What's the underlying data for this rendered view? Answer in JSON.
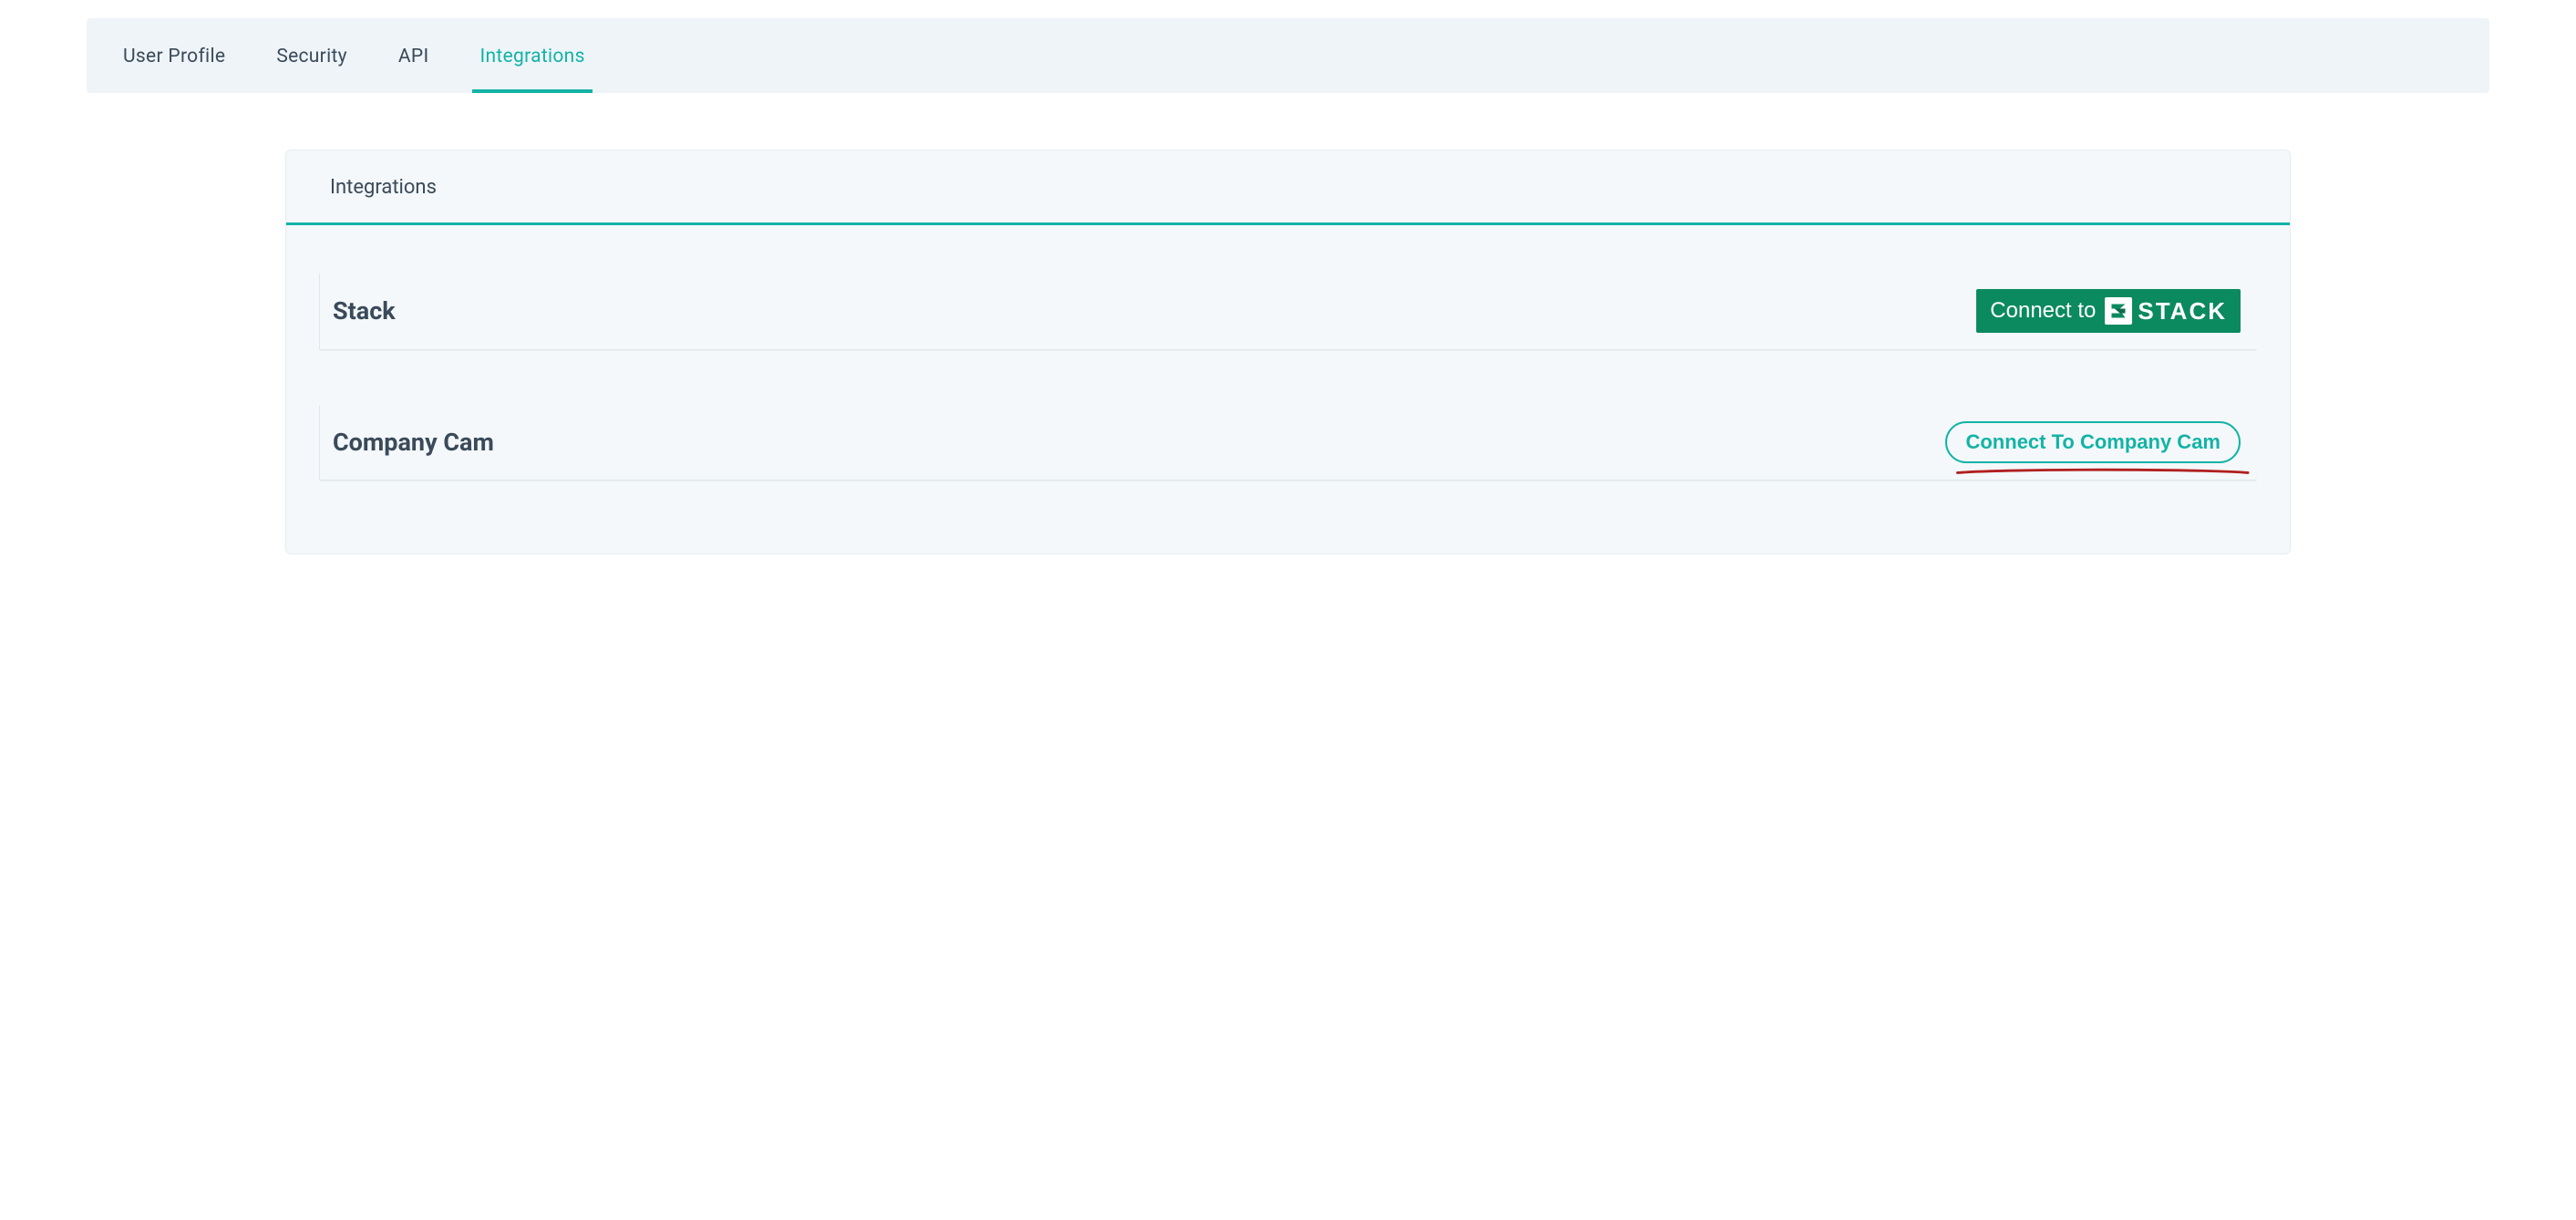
{
  "tabs": {
    "items": [
      {
        "label": "User Profile",
        "active": false
      },
      {
        "label": "Security",
        "active": false
      },
      {
        "label": "API",
        "active": false
      },
      {
        "label": "Integrations",
        "active": true
      }
    ]
  },
  "card": {
    "header": "Integrations",
    "integrations": [
      {
        "title": "Stack",
        "connectPrefix": "Connect to",
        "logoWord": "STACK"
      },
      {
        "title": "Company Cam",
        "connectLabel": "Connect To Company Cam"
      }
    ]
  },
  "colors": {
    "accent": "#13b3a6",
    "stackGreen": "#0b8a5f",
    "highlightRed": "#b11f1f"
  }
}
